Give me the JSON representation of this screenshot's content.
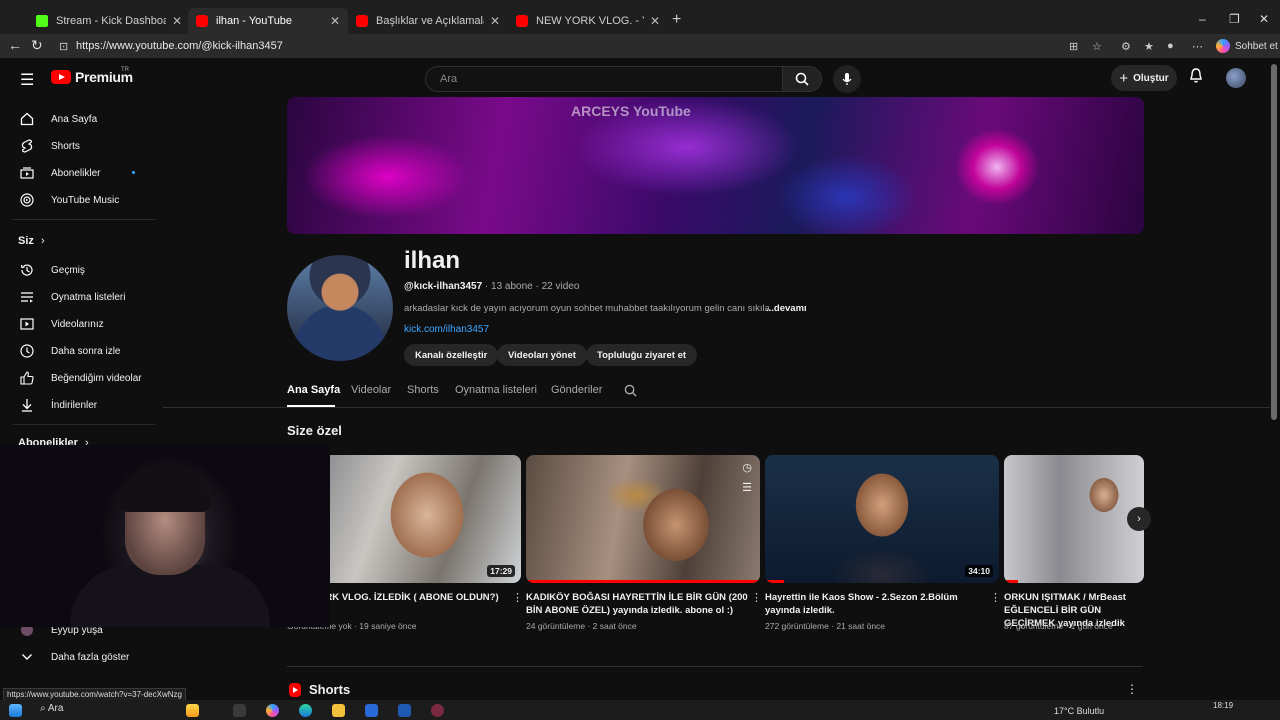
{
  "browser": {
    "tabs": [
      {
        "title": "Stream - Kick Dashboard",
        "favicon": "kick-icon"
      },
      {
        "title": "ilhan - YouTube",
        "favicon": "youtube-icon",
        "active": true
      },
      {
        "title": "Başlıklar ve Açıklamalar Hâlâ Öne...",
        "favicon": "youtube-icon"
      },
      {
        "title": "NEW YORK VLOG. - YouTube",
        "favicon": "youtube-icon"
      }
    ],
    "url": "https://www.youtube.com/@kick-ilhan3457",
    "copilot_label": "Sohbet et",
    "status_url": "https://www.youtube.com/watch?v=37-decXwNzg"
  },
  "masthead": {
    "logo_text": "Premium",
    "logo_region": "TR",
    "search_placeholder": "Ara",
    "create_label": "Oluştur"
  },
  "sidebar": {
    "items": [
      {
        "label": "Ana Sayfa",
        "icon": "home-icon"
      },
      {
        "label": "Shorts",
        "icon": "shorts-icon"
      },
      {
        "label": "Abonelikler",
        "icon": "subscriptions-icon"
      },
      {
        "label": "YouTube Music",
        "icon": "music-icon"
      }
    ],
    "you_header": "Siz",
    "you_items": [
      {
        "label": "Geçmiş",
        "icon": "history-icon"
      },
      {
        "label": "Oynatma listeleri",
        "icon": "playlists-icon"
      },
      {
        "label": "Videolarınız",
        "icon": "your-videos-icon"
      },
      {
        "label": "Daha sonra izle",
        "icon": "watch-later-icon"
      },
      {
        "label": "Beğendiğim videolar",
        "icon": "like-icon"
      },
      {
        "label": "İndirilenler",
        "icon": "download-icon"
      }
    ],
    "subs_header": "Abonelikler",
    "sub_channel": "Eyyup yuşa",
    "show_more": "Daha fazla göster"
  },
  "channel": {
    "name": "ilhan",
    "handle": "@kıck-ilhan3457",
    "subscribers": "13 abone",
    "videos": "22 video",
    "description": "arkadaslar kıck de yayın acıyorum oyun sohbet muhabbet taakılıyorum gelin canı sıkıla",
    "more": "...devamı",
    "link": "kick.com/ilhan3457",
    "banner_text": "ARCEYS YouTube",
    "buttons": [
      "Kanalı özelleştir",
      "Videoları yönet",
      "Topluluğu ziyaret et"
    ],
    "tabs": [
      "Ana Sayfa",
      "Videolar",
      "Shorts",
      "Oynatma listeleri",
      "Gönderiler"
    ]
  },
  "section": {
    "title": "Size özel",
    "videos": [
      {
        "title": "NEW YORK VLOG. İZLEDİK ( ABONE OLDUN?)",
        "views": "Görüntüleme yok",
        "age": "19 saniye önce",
        "duration": "17:29",
        "progress": 0
      },
      {
        "title": "KADIKÖY BOĞASI HAYRETTİN İLE BİR GÜN (200 BİN ABONE ÖZEL) yayında izledik. abone ol :)",
        "views": "24 görüntüleme",
        "age": "2 saat önce",
        "duration": "",
        "progress": 1.0
      },
      {
        "title": "Hayrettin ile Kaos Show - 2.Sezon 2.Bölüm yayında izledik.",
        "views": "272 görüntüleme",
        "age": "21 saat önce",
        "duration": "34:10",
        "progress": 0.08
      },
      {
        "title": "ORKUN IŞITMAK / MrBeast EĞLENCELİ BİR GÜN GEÇİRMEK yayında izledik",
        "views": "87 görüntüleme",
        "age": "1 gün önce",
        "duration": "",
        "progress": 0.1
      }
    ]
  },
  "shorts_section": {
    "title": "Shorts"
  },
  "taskbar": {
    "search": "Ara",
    "weather": "17°C  Bulutlu",
    "time": "18:19"
  },
  "colors": {
    "accent": "#ff0000",
    "link": "#3ea6ff",
    "background": "#0f0f0f"
  }
}
